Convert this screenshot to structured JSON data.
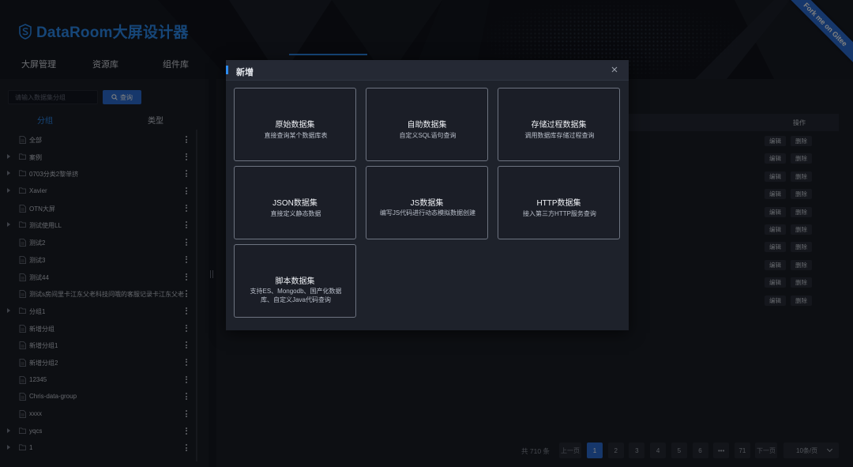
{
  "header": {
    "logo_text": "DataRoom大屏设计器",
    "ribbon": "Fork me on Gitee",
    "nav": [
      "大屏管理",
      "资源库",
      "组件库"
    ]
  },
  "sidebar": {
    "search_placeholder": "请输入数据集分组",
    "query_label": "查询",
    "tabs": [
      "分组",
      "类型"
    ],
    "tree": [
      {
        "label": "全部",
        "type": "file",
        "expandable": false
      },
      {
        "label": "案例",
        "type": "folder",
        "expandable": true
      },
      {
        "label": "0703分类2黎单挤",
        "type": "folder",
        "expandable": true
      },
      {
        "label": "Xavier",
        "type": "folder",
        "expandable": true
      },
      {
        "label": "OTN大屏",
        "type": "file",
        "expandable": false
      },
      {
        "label": "测试使用LL",
        "type": "folder",
        "expandable": true
      },
      {
        "label": "测试2",
        "type": "file",
        "expandable": false
      },
      {
        "label": "测试3",
        "type": "file",
        "expandable": false
      },
      {
        "label": "测试44",
        "type": "file",
        "expandable": false
      },
      {
        "label": "测试s房间里卡江东父老科技问哦的客服记录卡江东父老",
        "type": "file",
        "expandable": false
      },
      {
        "label": "分组1",
        "type": "folder",
        "expandable": true
      },
      {
        "label": "新增分组",
        "type": "file",
        "expandable": false
      },
      {
        "label": "新增分组1",
        "type": "file",
        "expandable": false
      },
      {
        "label": "新增分组2",
        "type": "file",
        "expandable": false
      },
      {
        "label": "12345",
        "type": "file",
        "expandable": false
      },
      {
        "label": "Chris-data-group",
        "type": "file",
        "expandable": false
      },
      {
        "label": "xxxx",
        "type": "file",
        "expandable": false
      },
      {
        "label": "yqcs",
        "type": "folder",
        "expandable": true
      },
      {
        "label": "1",
        "type": "folder",
        "expandable": true
      }
    ]
  },
  "table": {
    "ops_header": "操作",
    "edit_label": "编辑",
    "delete_label": "删除",
    "row_count": 10
  },
  "pagination": {
    "total": "共 710 条",
    "prev": "上一页",
    "pages": [
      "1",
      "2",
      "3",
      "4",
      "5",
      "6",
      "•••",
      "71"
    ],
    "active_page": "1",
    "next": "下一页",
    "page_size": "10条/页"
  },
  "dialog": {
    "title": "新增",
    "cards": [
      {
        "title": "原始数据集",
        "desc": "直接查询某个数据库表"
      },
      {
        "title": "自助数据集",
        "desc": "自定义SQL语句查询"
      },
      {
        "title": "存储过程数据集",
        "desc": "调用数据库存储过程查询"
      },
      {
        "title": "JSON数据集",
        "desc": "直接定义静态数据"
      },
      {
        "title": "JS数据集",
        "desc": "编写JS代码进行动态模拟数据创建"
      },
      {
        "title": "HTTP数据集",
        "desc": "接入第三方HTTP服务查询"
      },
      {
        "title": "脚本数据集",
        "desc": "支持ES、Mongodb、国产化数据库、自定义Java代码查询"
      }
    ]
  },
  "colors": {
    "accent": "#2d8cf0",
    "background": "#151821",
    "panel": "#1b1e27"
  }
}
